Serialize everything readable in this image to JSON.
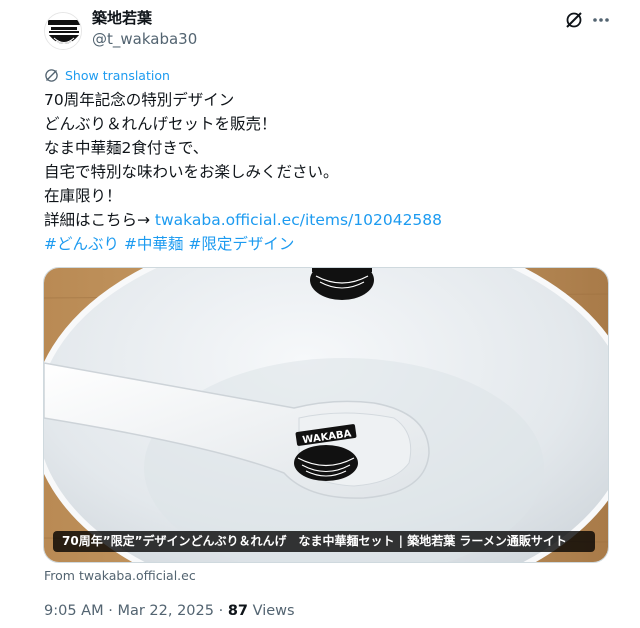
{
  "author": {
    "display_name": "築地若葉",
    "handle": "@t_wakaba30",
    "avatar_icon": "brand-logo-avatar"
  },
  "header_icons": {
    "grok": "grok-icon",
    "more": "more-icon"
  },
  "translation": {
    "label": "Show translation",
    "icon": "translate-icon"
  },
  "tweet": {
    "line1": "70周年記念の特別デザイン",
    "line2": "どんぶり＆れんげセットを販売！",
    "line3": "なま中華麺2食付きで、",
    "line4": "自宅で特別な味わいをお楽しみください。",
    "line5": "在庫限り！",
    "line6_prefix": "詳細はこちら→ ",
    "link_text": "twakaba.official.ec/items/102042588",
    "hashtags": [
      "#どんぶり",
      "#中華麺",
      "#限定デザイン"
    ]
  },
  "card": {
    "title": "70周年”限定”デザインどんぶり＆れんげ　なま中華麺セット | 築地若葉 ラーメン通販サイト",
    "source": "From twakaba.official.ec"
  },
  "meta": {
    "time": "9:05 AM",
    "separator": " · ",
    "date": "Mar 22, 2025",
    "views_count": "87",
    "views_label": " Views"
  },
  "colors": {
    "accent": "#1d9bf0",
    "text": "#0f1419",
    "secondary": "#536471"
  }
}
